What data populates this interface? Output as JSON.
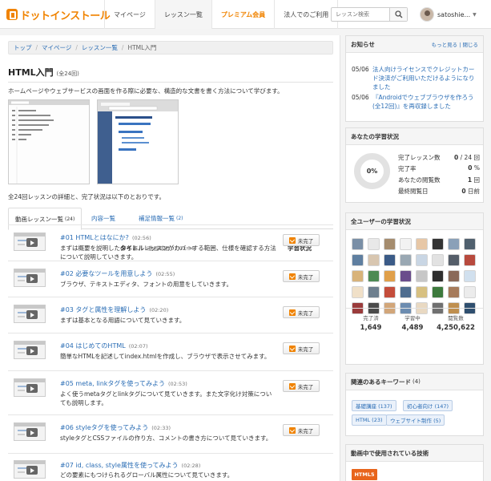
{
  "header": {
    "logo": "ドットインストール",
    "nav": [
      "マイページ",
      "レッスン一覧",
      "プレミアム会員",
      "法人でのご利用"
    ],
    "search_placeholder": "レッスン検索",
    "user_name": "satoshie..."
  },
  "breadcrumb": [
    "トップ",
    "マイページ",
    "レッスン一覧",
    "HTML入門"
  ],
  "course": {
    "title": "HTML入門",
    "count": "(全24回)",
    "description": "ホームページやウェブサービスの画面を作る際に必要な、構造的な文書を書く方法について学びます。",
    "summary": "全24回レッスンの詳細と、完了状況は以下のとおりです。"
  },
  "tabs": [
    {
      "label": "動画レッスン一覧",
      "count": "(24)"
    },
    {
      "label": "内容一覧",
      "count": ""
    },
    {
      "label": "補足情報一覧",
      "count": "(2)"
    }
  ],
  "table": {
    "title_header": "タイトル",
    "total_duration": "(動画時間 01:02:34)",
    "status_header": "学習状況"
  },
  "lessons": [
    {
      "title": "#01 HTMLとはなにか?",
      "duration": "(02:56)",
      "desc": "まずは概要を説明したのちに、レッスンがカバーする範囲、仕様を確認する方法について説明していきます。",
      "status": "未完了"
    },
    {
      "title": "#02 必要なツールを用意しよう",
      "duration": "(02:55)",
      "desc": "ブラウザ、テキストエディタ、フォントの用意をしていきます。",
      "status": "未完了"
    },
    {
      "title": "#03 タグと属性を理解しよう",
      "duration": "(02:20)",
      "desc": "まずは基本となる用語について見ていきます。",
      "status": "未完了"
    },
    {
      "title": "#04 はじめてのHTML",
      "duration": "(02:07)",
      "desc": "簡単なHTMLを記述してindex.htmlを作成し、ブラウザで表示させてみます。",
      "status": "未完了"
    },
    {
      "title": "#05 meta, linkタグを使ってみよう",
      "duration": "(02:53)",
      "desc": "よく使うmetaタグとlinkタグについて見ていきます。また文字化け対策についても説明します。",
      "status": "未完了"
    },
    {
      "title": "#06 styleタグを使ってみよう",
      "duration": "(02:33)",
      "desc": "styleタグとCSSファイルの作り方、コメントの書き方について見ていきます。",
      "status": "未完了"
    },
    {
      "title": "#07 id, class, style属性を使ってみよう",
      "duration": "(02:28)",
      "desc": "どの要素にもつけられるグローバル属性について見ていきます。",
      "status": ""
    }
  ],
  "notices": {
    "heading": "お知らせ",
    "links": "もっと見る | 閉じる",
    "items": [
      {
        "date": "05/06",
        "text": "法人向けライセンスでクレジットカード決済がご利用いただけるようになりました"
      },
      {
        "date": "05/06",
        "text": "『Androidでウェブブラウザを作ろう(全12回)』を再収録しました"
      }
    ]
  },
  "progress": {
    "heading": "あなたの学習状況",
    "percent": "0%",
    "rows": [
      {
        "label": "完了レッスン数",
        "value_bold": "0",
        "value_rest": " / 24 回"
      },
      {
        "label": "完了率",
        "value_bold": "0",
        "value_rest": " %"
      },
      {
        "label": "あなたの閲覧数",
        "value_bold": "1",
        "value_rest": " 回"
      },
      {
        "label": "最終閲覧日",
        "value_bold": "0",
        "value_rest": " 日前"
      }
    ]
  },
  "all_users": {
    "heading": "全ユーザーの学習状況",
    "totals": [
      {
        "label": "完了済",
        "value": "1,649"
      },
      {
        "label": "学習中",
        "value": "4,489"
      },
      {
        "label": "閲覧数",
        "value": "4,250,622"
      }
    ],
    "avatar_colors": [
      "#7a8fa6",
      "#e8e8e8",
      "#a58c6e",
      "#f2f2f2",
      "#e7c7a6",
      "#333333",
      "#8aa0b8",
      "#50606e",
      "#5f7fa0",
      "#d8c6b0",
      "#3b5b87",
      "#9aa8b3",
      "#c9d6e4",
      "#e2e2e2",
      "#555e69",
      "#b84a3e",
      "#d8b37a",
      "#4d8a53",
      "#e0a04a",
      "#6a4d8c",
      "#c7c7c7",
      "#2e2e2e",
      "#8a6a5a",
      "#d1e0ee",
      "#f0e0c8",
      "#6e7f8e",
      "#c44d3b",
      "#4f6d8f",
      "#d7c081",
      "#3d7a3d",
      "#a67b5b",
      "#ececec",
      "#9a3b3b",
      "#4b4b4b",
      "#d2a679",
      "#6c8cb0",
      "#e9d9c2",
      "#707070",
      "#bf8f4f",
      "#2f4f6f"
    ]
  },
  "keywords": {
    "heading": "関連のあるキーワード",
    "count": "(4)",
    "items": [
      "基礎講座 (137)",
      "初心者向け (147)",
      "HTML (23)",
      "ウェブサイト制作 (5)"
    ]
  },
  "tech": {
    "heading": "動画中で使用されている技術",
    "badge": "HTML5"
  },
  "colors": {
    "brand": "#f08300",
    "link": "#2a6db5"
  }
}
